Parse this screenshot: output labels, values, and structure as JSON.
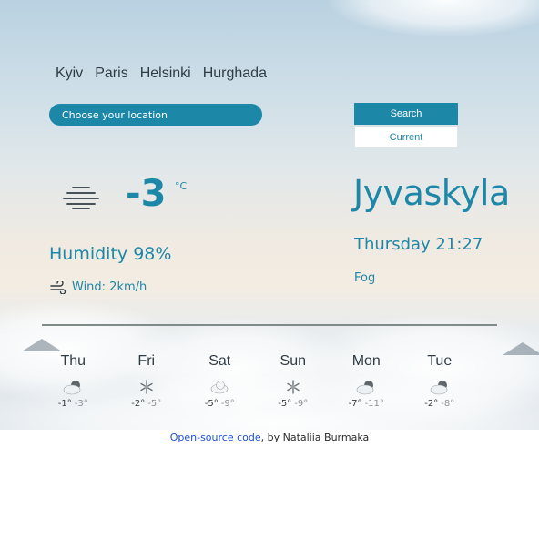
{
  "header": {
    "cities": [
      "Kyiv",
      "Paris",
      "Helsinki",
      "Hurghada"
    ]
  },
  "search": {
    "placeholder": "Choose your location",
    "search_label": "Search",
    "current_label": "Current"
  },
  "current": {
    "icon": "fog-icon",
    "temperature": "-3",
    "unit": "°C",
    "humidity": "Humidity 98%",
    "wind": "Wind: 2km/h",
    "city": "Jyvaskyla",
    "datetime": "Thursday 21:27",
    "condition": "Fog"
  },
  "forecast": [
    {
      "day": "Thu",
      "icon": "cloud-icon",
      "max": "-1°",
      "min": "-3°"
    },
    {
      "day": "Fri",
      "icon": "snowflake-icon",
      "max": "-2°",
      "min": "-5°"
    },
    {
      "day": "Sat",
      "icon": "cloud-icon",
      "max": "-5°",
      "min": "-9°"
    },
    {
      "day": "Sun",
      "icon": "snowflake-icon",
      "max": "-5°",
      "min": "-9°"
    },
    {
      "day": "Mon",
      "icon": "cloud-icon",
      "max": "-7°",
      "min": "-11°"
    },
    {
      "day": "Tue",
      "icon": "cloud-icon",
      "max": "-2°",
      "min": "-8°"
    }
  ],
  "footer": {
    "link_text": "Open-source code",
    "author_text": ", by Nataliia Burmaka"
  },
  "colors": {
    "accent": "#1d87a7",
    "divider": "#7e8b88",
    "link": "#1a4fd8"
  }
}
